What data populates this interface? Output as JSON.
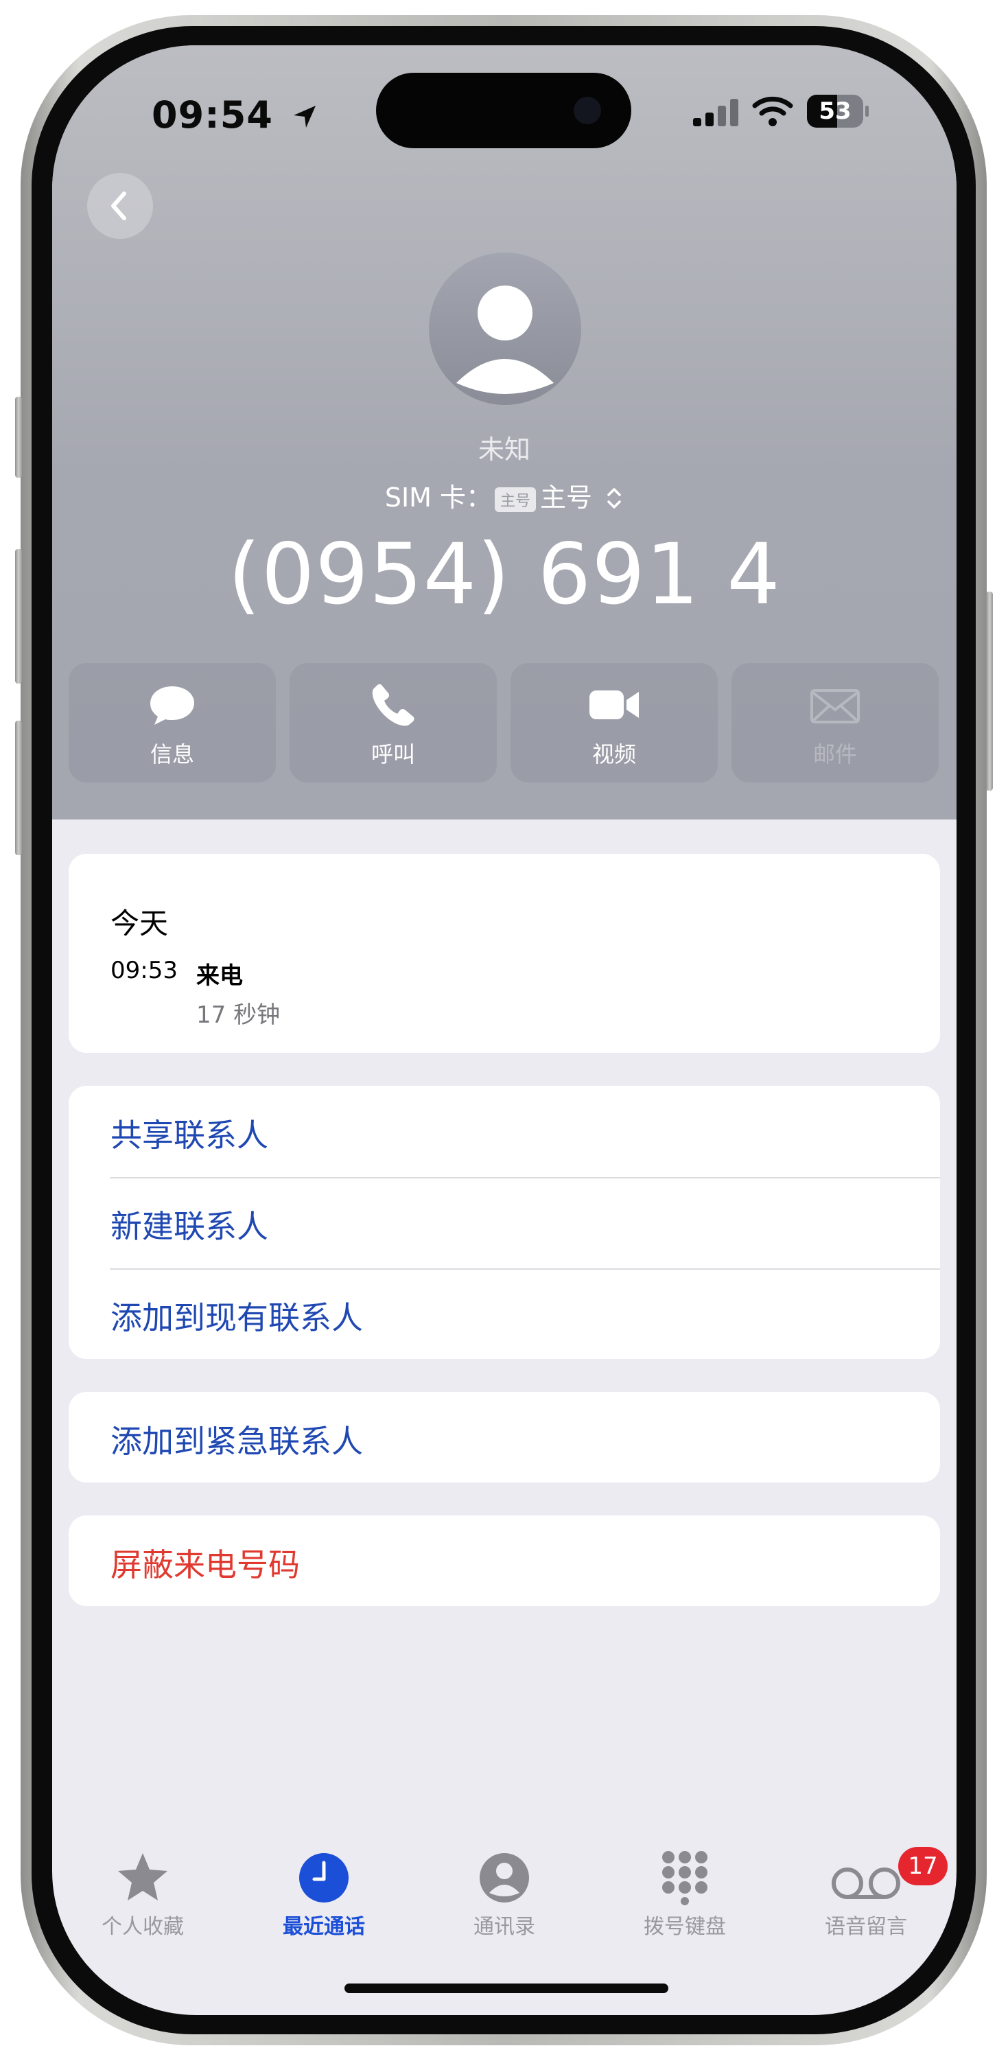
{
  "status_bar": {
    "time": "09:54",
    "battery": "53"
  },
  "contact": {
    "name": "未知",
    "sim_label": "SIM 卡：",
    "sim_tag": "主号",
    "sim_value": "主号",
    "phone_number": "(0954) 691 4"
  },
  "actions": [
    {
      "label": "信息",
      "icon": "message-icon",
      "enabled": true
    },
    {
      "label": "呼叫",
      "icon": "phone-icon",
      "enabled": true
    },
    {
      "label": "视频",
      "icon": "video-icon",
      "enabled": true
    },
    {
      "label": "邮件",
      "icon": "mail-icon",
      "enabled": false
    }
  ],
  "recent": {
    "day": "今天",
    "entries": [
      {
        "time": "09:53",
        "type": "来电",
        "duration": "17 秒钟"
      }
    ]
  },
  "contact_options": [
    "共享联系人",
    "新建联系人",
    "添加到现有联系人"
  ],
  "emergency_option": "添加到紧急联系人",
  "block_option": "屏蔽来电号码",
  "tabs": [
    {
      "label": "个人收藏",
      "icon": "star-icon",
      "active": false
    },
    {
      "label": "最近通话",
      "icon": "clock-icon",
      "active": true
    },
    {
      "label": "通讯录",
      "icon": "contacts-icon",
      "active": false
    },
    {
      "label": "拨号键盘",
      "icon": "keypad-icon",
      "active": false
    },
    {
      "label": "语音留言",
      "icon": "voicemail-icon",
      "active": false,
      "badge": "17"
    }
  ],
  "colors": {
    "link": "#1f48b2",
    "danger": "#e03a30",
    "active_tab": "#1c4fd8",
    "badge": "#e5262f"
  }
}
